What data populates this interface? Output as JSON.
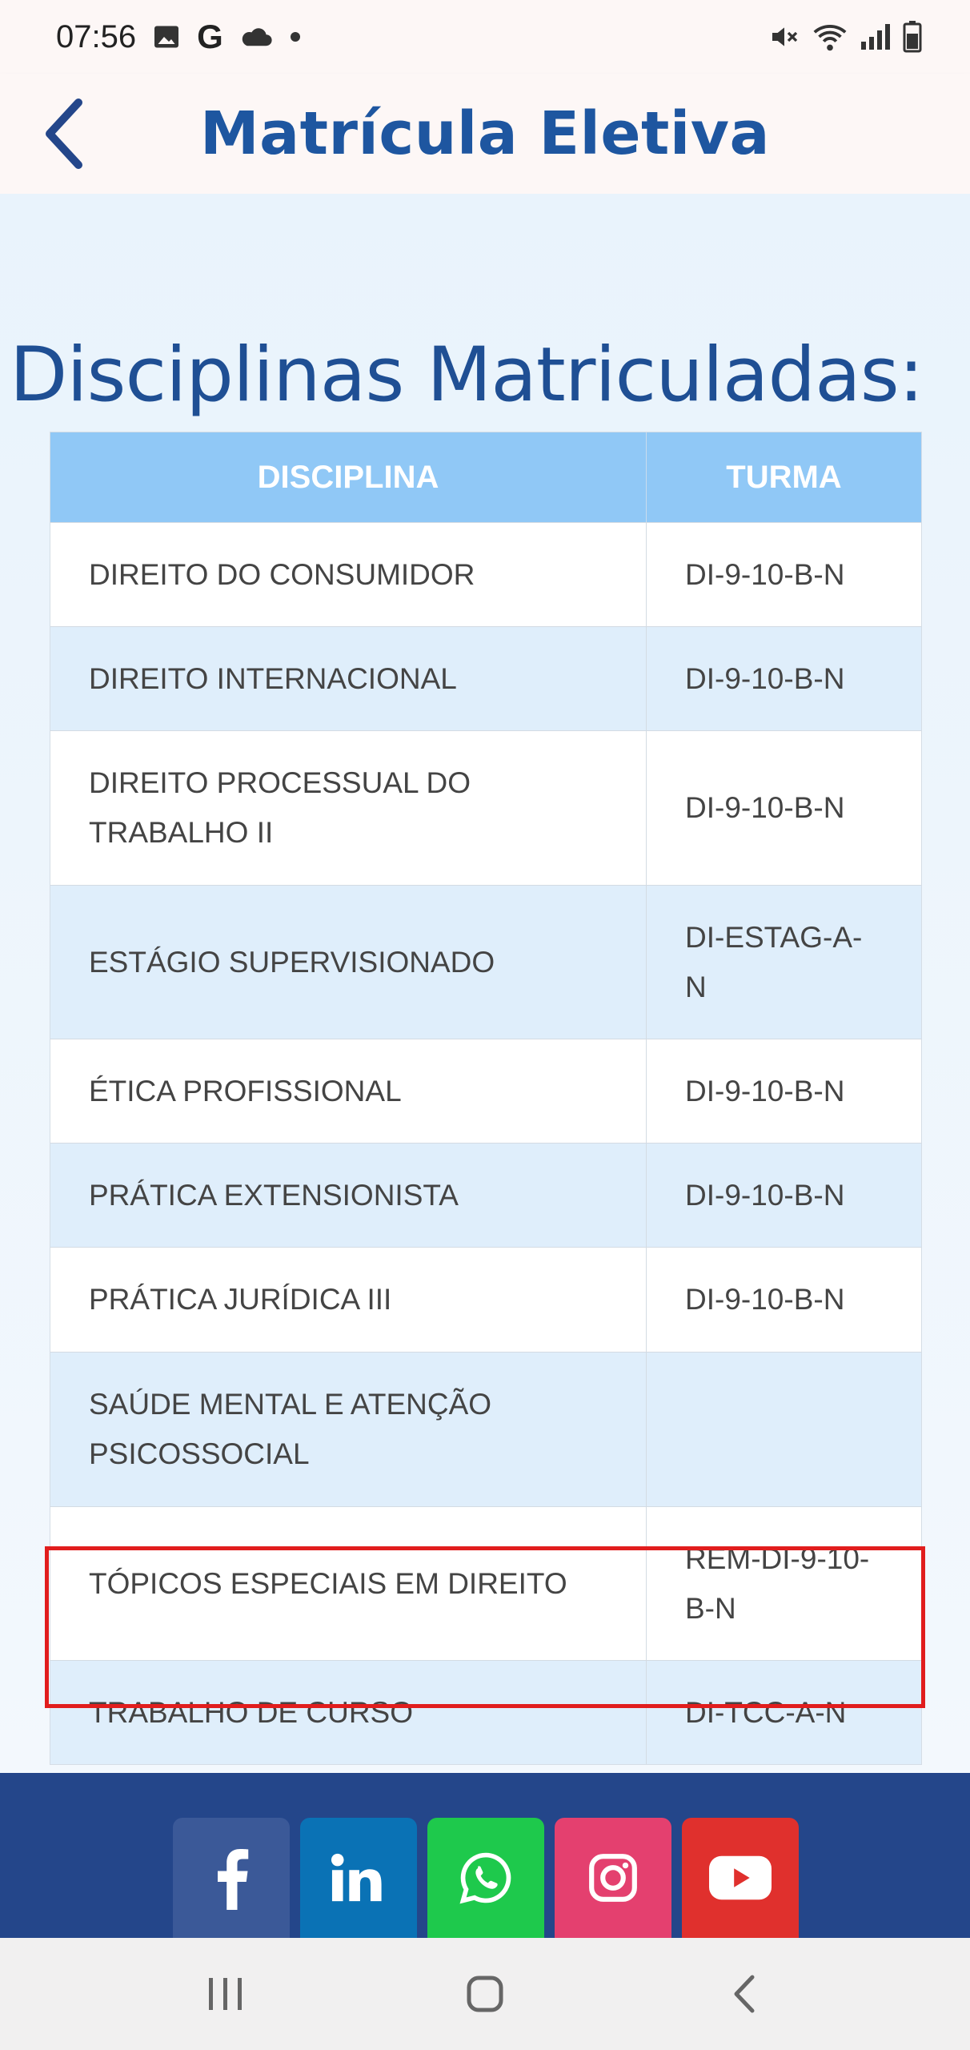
{
  "status_bar": {
    "time": "07:56",
    "left_icons": [
      "image-icon",
      "google-icon",
      "cloud-icon",
      "dot-icon"
    ],
    "right_icons": [
      "mute-icon",
      "wifi-icon",
      "signal-icon",
      "battery-icon"
    ]
  },
  "header": {
    "title": "Matrícula Eletiva",
    "back_icon": "chevron-left-icon"
  },
  "section": {
    "heading": "Disciplinas Matriculadas:"
  },
  "table": {
    "columns": [
      "DISCIPLINA",
      "TURMA"
    ],
    "rows": [
      {
        "disciplina": "DIREITO DO CONSUMIDOR",
        "turma": "DI-9-10-B-N"
      },
      {
        "disciplina": "DIREITO INTERNACIONAL",
        "turma": "DI-9-10-B-N"
      },
      {
        "disciplina": "DIREITO PROCESSUAL DO TRABALHO II",
        "turma": "DI-9-10-B-N"
      },
      {
        "disciplina": "ESTÁGIO SUPERVISIONADO",
        "turma": "DI-ESTAG-A-N"
      },
      {
        "disciplina": "ÉTICA PROFISSIONAL",
        "turma": "DI-9-10-B-N"
      },
      {
        "disciplina": "PRÁTICA EXTENSIONISTA",
        "turma": "DI-9-10-B-N"
      },
      {
        "disciplina": "PRÁTICA JURÍDICA III",
        "turma": "DI-9-10-B-N"
      },
      {
        "disciplina": "SAÚDE MENTAL E ATENÇÃO PSICOSSOCIAL",
        "turma": ""
      },
      {
        "disciplina": "TÓPICOS ESPECIAIS EM DIREITO",
        "turma": "REM-DI-9-10-B-N"
      },
      {
        "disciplina": "TRABALHO DE CURSO",
        "turma": "DI-TCC-A-N"
      }
    ]
  },
  "footer": {
    "social": [
      {
        "name": "facebook-icon",
        "color": "#3b5998"
      },
      {
        "name": "linkedin-icon",
        "color": "#0a72b5"
      },
      {
        "name": "whatsapp-icon",
        "color": "#1ec94c"
      },
      {
        "name": "instagram-icon",
        "color": "#e4406f"
      },
      {
        "name": "youtube-icon",
        "color": "#e0302d"
      }
    ]
  },
  "nav_bar": {
    "buttons": [
      "recents-icon",
      "home-icon",
      "back-icon"
    ]
  },
  "colors": {
    "title_blue": "#1e56a0",
    "heading_blue": "#1f4f94",
    "table_header": "#90c8f6",
    "alt_row": "#dfeefb",
    "highlight": "#e11d1d",
    "footer": "#24468a"
  }
}
